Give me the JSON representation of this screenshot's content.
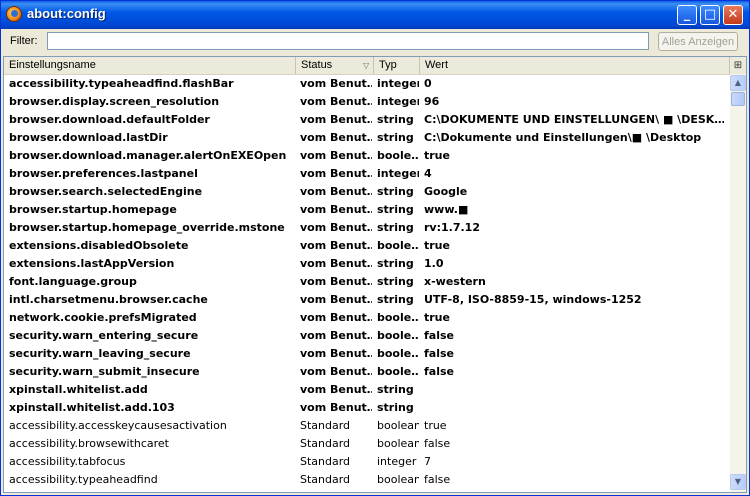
{
  "window": {
    "title": "about:config"
  },
  "filter": {
    "label": "Filter:",
    "value": "",
    "show_all_label": "Alles Anzeigen"
  },
  "columns": {
    "name": "Einstellungsname",
    "status": "Status",
    "type": "Typ",
    "value": "Wert"
  },
  "rows": [
    {
      "name": "accessibility.typeaheadfind.flashBar",
      "status": "vom Benut…",
      "type": "integer",
      "value": "0",
      "user": true
    },
    {
      "name": "browser.display.screen_resolution",
      "status": "vom Benut…",
      "type": "integer",
      "value": "96",
      "user": true
    },
    {
      "name": "browser.download.defaultFolder",
      "status": "vom Benut…",
      "type": "string",
      "value": "C:\\DOKUMENTE UND EINSTELLUNGEN\\ ■          \\DESK…",
      "user": true
    },
    {
      "name": "browser.download.lastDir",
      "status": "vom Benut…",
      "type": "string",
      "value": "C:\\Dokumente und Einstellungen\\■          \\Desktop",
      "user": true
    },
    {
      "name": "browser.download.manager.alertOnEXEOpen",
      "status": "vom Benut…",
      "type": "boole…",
      "value": "true",
      "user": true
    },
    {
      "name": "browser.preferences.lastpanel",
      "status": "vom Benut…",
      "type": "integer",
      "value": "4",
      "user": true
    },
    {
      "name": "browser.search.selectedEngine",
      "status": "vom Benut…",
      "type": "string",
      "value": "Google",
      "user": true
    },
    {
      "name": "browser.startup.homepage",
      "status": "vom Benut…",
      "type": "string",
      "value": "www.■",
      "user": true
    },
    {
      "name": "browser.startup.homepage_override.mstone",
      "status": "vom Benut…",
      "type": "string",
      "value": "rv:1.7.12",
      "user": true
    },
    {
      "name": "extensions.disabledObsolete",
      "status": "vom Benut…",
      "type": "boole…",
      "value": "true",
      "user": true
    },
    {
      "name": "extensions.lastAppVersion",
      "status": "vom Benut…",
      "type": "string",
      "value": "1.0",
      "user": true
    },
    {
      "name": "font.language.group",
      "status": "vom Benut…",
      "type": "string",
      "value": "x-western",
      "user": true
    },
    {
      "name": "intl.charsetmenu.browser.cache",
      "status": "vom Benut…",
      "type": "string",
      "value": "UTF-8, ISO-8859-15, windows-1252",
      "user": true
    },
    {
      "name": "network.cookie.prefsMigrated",
      "status": "vom Benut…",
      "type": "boole…",
      "value": "true",
      "user": true
    },
    {
      "name": "security.warn_entering_secure",
      "status": "vom Benut…",
      "type": "boole…",
      "value": "false",
      "user": true
    },
    {
      "name": "security.warn_leaving_secure",
      "status": "vom Benut…",
      "type": "boole…",
      "value": "false",
      "user": true
    },
    {
      "name": "security.warn_submit_insecure",
      "status": "vom Benut…",
      "type": "boole…",
      "value": "false",
      "user": true
    },
    {
      "name": "xpinstall.whitelist.add",
      "status": "vom Benut…",
      "type": "string",
      "value": "",
      "user": true
    },
    {
      "name": "xpinstall.whitelist.add.103",
      "status": "vom Benut…",
      "type": "string",
      "value": "",
      "user": true
    },
    {
      "name": "accessibility.accesskeycausesactivation",
      "status": "Standard",
      "type": "boolean",
      "value": "true",
      "user": false
    },
    {
      "name": "accessibility.browsewithcaret",
      "status": "Standard",
      "type": "boolean",
      "value": "false",
      "user": false
    },
    {
      "name": "accessibility.tabfocus",
      "status": "Standard",
      "type": "integer",
      "value": "7",
      "user": false
    },
    {
      "name": "accessibility.typeaheadfind",
      "status": "Standard",
      "type": "boolean",
      "value": "false",
      "user": false
    }
  ],
  "icons": {
    "app": "firefox-icon",
    "minimize": "minimize-icon",
    "maximize": "maximize-icon",
    "close": "close-icon",
    "sort": "sort-descending-icon",
    "column_picker": "column-picker-icon"
  }
}
